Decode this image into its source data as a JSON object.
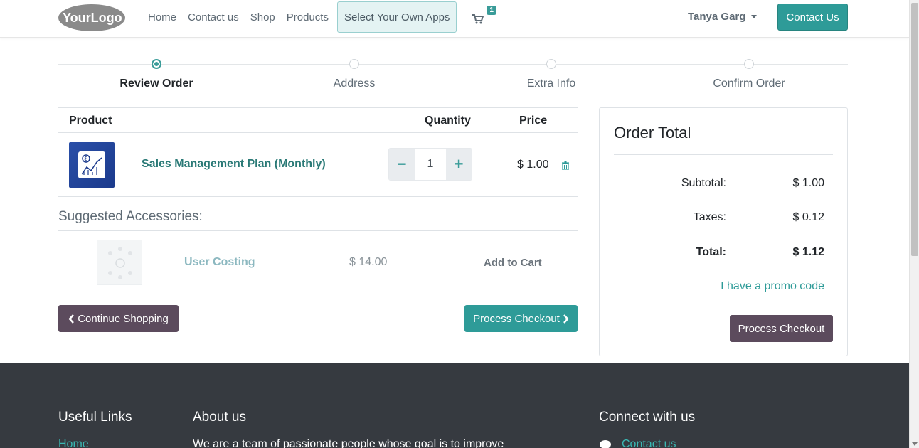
{
  "header": {
    "logo_text": "YourLogo",
    "nav": [
      "Home",
      "Contact us",
      "Shop",
      "Products"
    ],
    "select_apps_label": "Select Your Own Apps",
    "cart_count": "1",
    "user_name": "Tanya Garg",
    "contact_button": "Contact Us",
    "accent_color": "#2e9b98"
  },
  "steps": [
    {
      "label": "Review Order",
      "active": true
    },
    {
      "label": "Address",
      "active": false
    },
    {
      "label": "Extra Info",
      "active": false
    },
    {
      "label": "Confirm Order",
      "active": false
    }
  ],
  "cart_table": {
    "headers": {
      "product": "Product",
      "quantity": "Quantity",
      "price": "Price"
    },
    "items": [
      {
        "name": "Sales Management Plan (Monthly)",
        "quantity": "1",
        "price": "$ 1.00",
        "icon": "sales-chart-icon"
      }
    ]
  },
  "accessories": {
    "title": "Suggested Accessories:",
    "items": [
      {
        "name": "User Costing",
        "price": "$ 14.00",
        "action": "Add to Cart"
      }
    ]
  },
  "actions": {
    "continue_label": "Continue Shopping",
    "process_label": "Process Checkout"
  },
  "order_total": {
    "title": "Order Total",
    "subtotal_label": "Subtotal:",
    "subtotal_value": "$ 1.00",
    "taxes_label": "Taxes:",
    "taxes_value": "$ 0.12",
    "total_label": "Total:",
    "total_value": "$ 1.12",
    "promo_label": "I have a promo code",
    "checkout_label": "Process Checkout"
  },
  "footer": {
    "useful_links_title": "Useful Links",
    "useful_links": [
      "Home"
    ],
    "about_title": "About us",
    "about_text": "We are a team of passionate people whose goal is to improve",
    "connect_title": "Connect with us",
    "connect_links": [
      "Contact us"
    ]
  }
}
